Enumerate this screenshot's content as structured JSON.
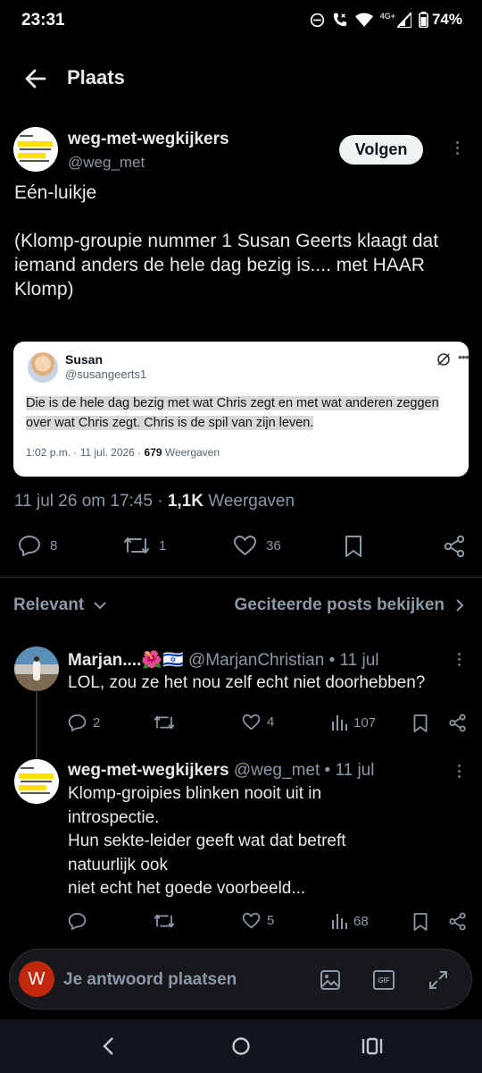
{
  "status_bar": {
    "time": "23:31",
    "network_label": "4G+",
    "battery": "74%",
    "icons": [
      "do-not-disturb-icon",
      "wifi-calling-icon",
      "wifi-icon",
      "signal-icon",
      "battery-icon"
    ]
  },
  "header": {
    "title": "Plaats",
    "back_icon": "arrow-left-icon"
  },
  "post": {
    "author_name": "weg-met-wegkijkers",
    "author_handle": "@weg_met",
    "follow_label": "Volgen",
    "text": "Eén-luikje\n\n(Klomp-groupie nummer 1 Susan Geerts klaagt dat\niemand anders de hele dag bezig is.... met HAAR Klomp)",
    "quoted": {
      "name": "Susan",
      "handle": "@susangeerts1",
      "text": "Die is de hele dag bezig met wat Chris zegt en met wat anderen zeggen over wat Chris zegt. Chris is de spil van zijn leven.",
      "meta_time": "1:02 p.m. · 11 jul. 2026 · ",
      "meta_views": "679",
      "meta_views_label": " Weergaven"
    },
    "timestamp": "11 jul 26 om 17:45 · ",
    "views": "1,1K",
    "views_label": " Weergaven",
    "actions": {
      "replies": "8",
      "reposts": "1",
      "likes": "36"
    }
  },
  "sort": {
    "label": "Relevant",
    "quotes_link": "Geciteerde posts bekijken"
  },
  "replies": [
    {
      "name": "Marjan....🌺🇮🇱",
      "handle": "@MarjanChristian",
      "date": " • 11 jul",
      "text": "LOL, zou ze het nou zelf echt niet doorhebben?",
      "replies": "2",
      "reposts": "",
      "likes": "4",
      "views": "107"
    },
    {
      "name": "weg-met-wegkijkers",
      "handle": "@weg_met",
      "date": " • 11 jul",
      "text": "Klomp-groipies blinken nooit uit in\nintrospectie.\nHun sekte-leider geeft wat dat betreft\nnatuurlijk ook\nniet echt het goede voorbeeld...",
      "replies": "",
      "reposts": "",
      "likes": "5",
      "views": "68"
    }
  ],
  "compose": {
    "avatar_letter": "W",
    "placeholder": "Je antwoord plaatsen",
    "gif_label": "GIF"
  },
  "colors": {
    "background": "#000000",
    "text": "#e7e9ea",
    "muted": "#8b98a5",
    "follow_button": "#eff3f4",
    "compose_avatar": "#c2260c"
  }
}
